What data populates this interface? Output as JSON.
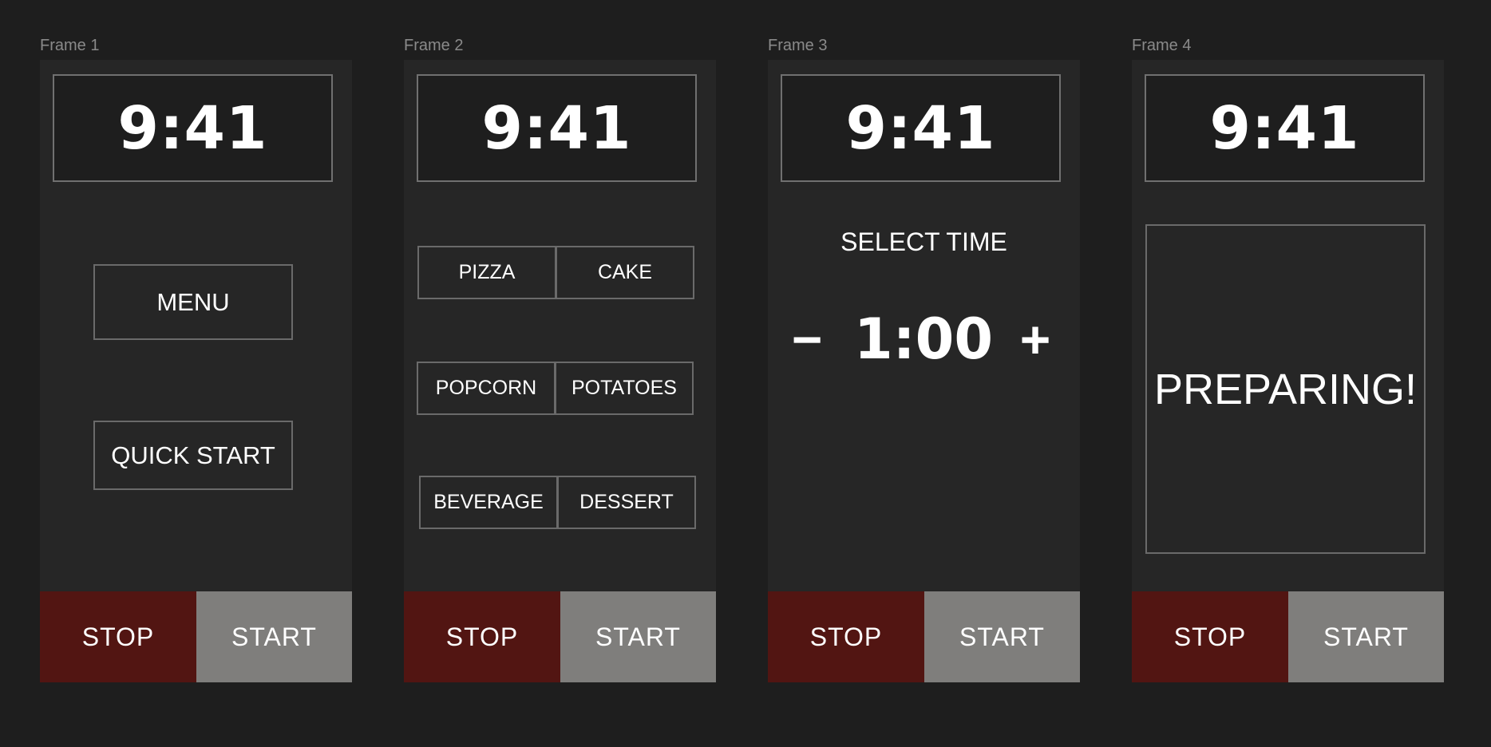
{
  "frames": [
    {
      "label": "Frame 1",
      "clock": "9:41"
    },
    {
      "label": "Frame 2",
      "clock": "9:41"
    },
    {
      "label": "Frame 3",
      "clock": "9:41"
    },
    {
      "label": "Frame 4",
      "clock": "9:41"
    }
  ],
  "controls": {
    "stop_label": "STOP",
    "start_label": "START"
  },
  "home": {
    "menu_label": "MENU",
    "quick_start_label": "QUICK START"
  },
  "menu": {
    "items": [
      "PIZZA",
      "CAKE",
      "POPCORN",
      "POTATOES",
      "BEVERAGE",
      "DESSERT"
    ]
  },
  "time_select": {
    "title": "SELECT TIME",
    "minus": "−",
    "value": "1:00",
    "plus": "+"
  },
  "status": {
    "text": "PREPARING!"
  },
  "colors": {
    "stop": "#521512",
    "start": "#7f7e7c",
    "panel": "#262626",
    "background": "#1e1e1e"
  }
}
